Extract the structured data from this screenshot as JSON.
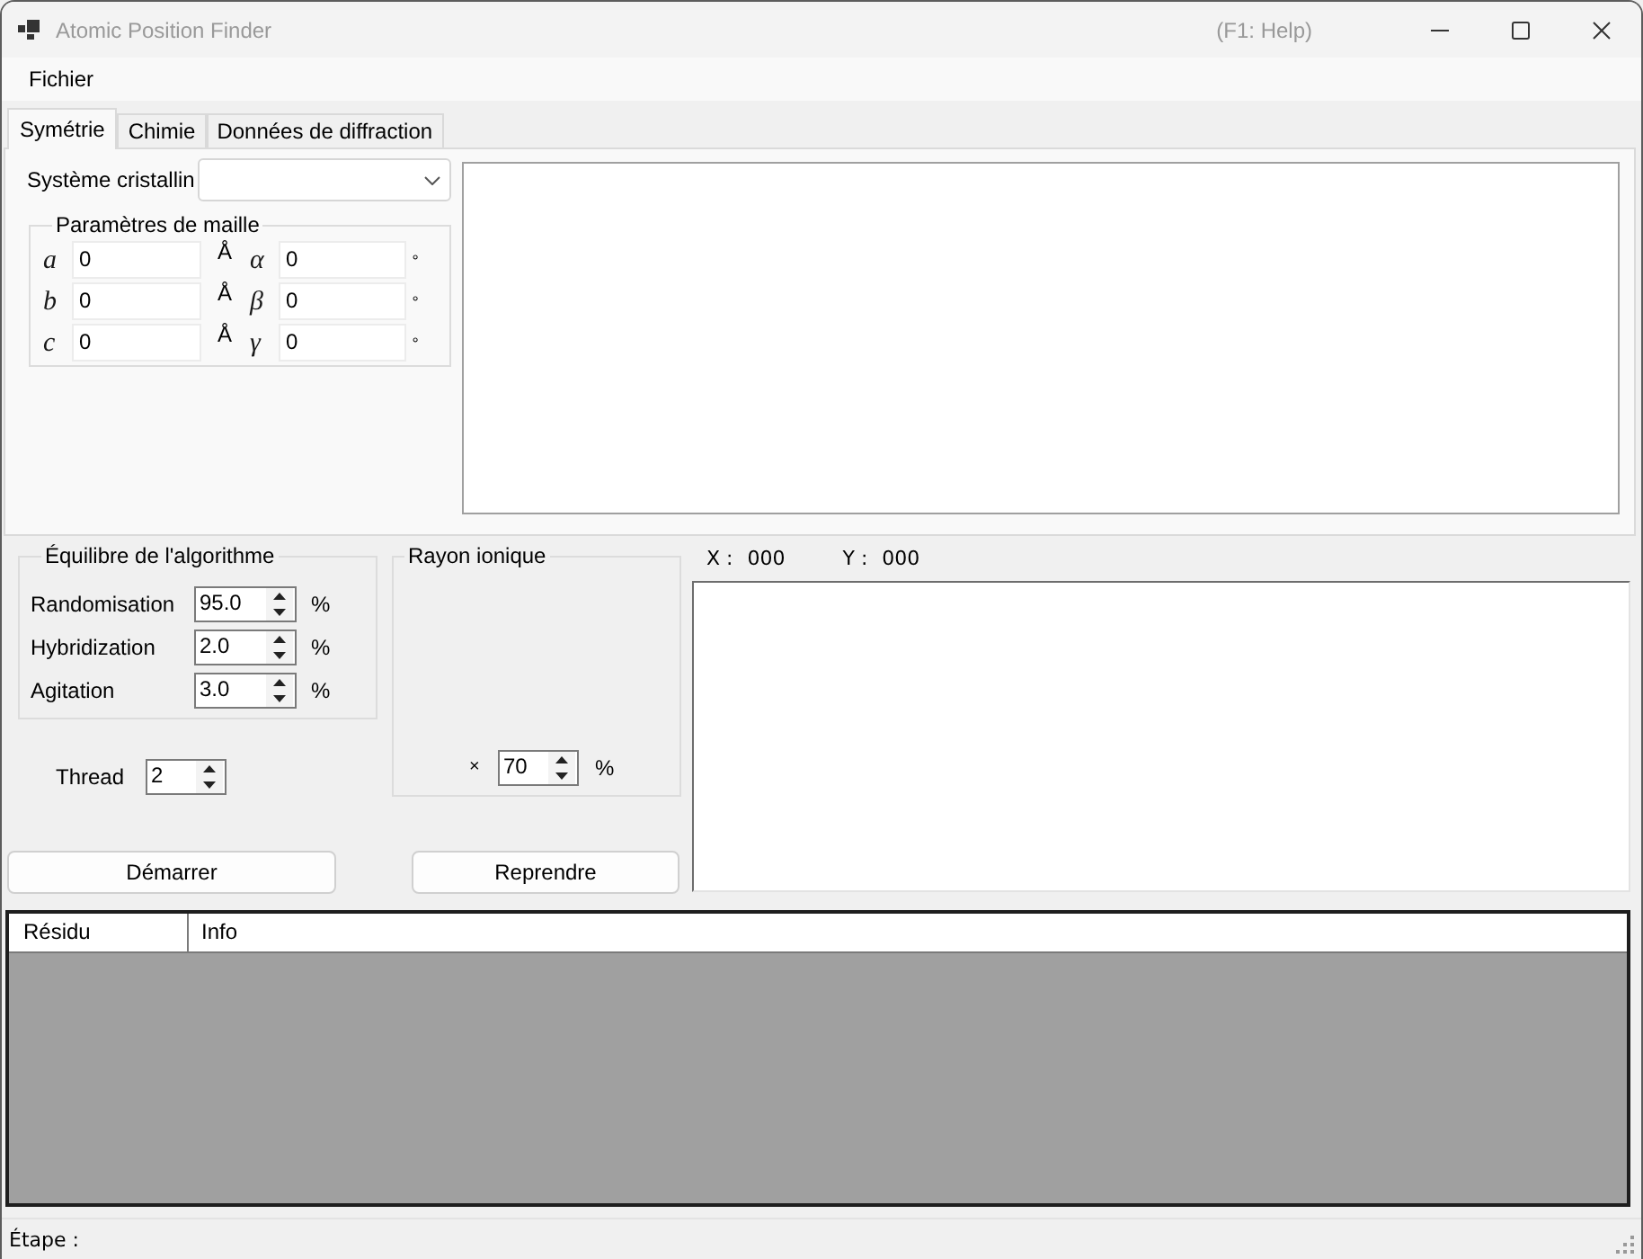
{
  "window": {
    "title": "Atomic Position Finder",
    "help_hint": "(F1: Help)"
  },
  "menu": [
    {
      "label": "Fichier"
    }
  ],
  "tabs": [
    {
      "label": "Symétrie",
      "selected": true
    },
    {
      "label": "Chimie",
      "selected": false
    },
    {
      "label": "Données de diffraction",
      "selected": false
    }
  ],
  "symmetry": {
    "crystal_system": {
      "label": "Système cristallin"
    },
    "lattice": {
      "title": "Paramètres de maille",
      "rows": [
        {
          "length": {
            "symbol": "a",
            "value": "0",
            "unit": "Å"
          },
          "angle": {
            "symbol": "α",
            "value": "0",
            "unit": "°"
          }
        },
        {
          "length": {
            "symbol": "b",
            "value": "0",
            "unit": "Å"
          },
          "angle": {
            "symbol": "β",
            "value": "0",
            "unit": "°"
          }
        },
        {
          "length": {
            "symbol": "c",
            "value": "0",
            "unit": "Å"
          },
          "angle": {
            "symbol": "γ",
            "value": "0",
            "unit": "°"
          }
        }
      ]
    }
  },
  "balance": {
    "title": "Équilibre de l'algorithme",
    "rows": [
      {
        "label": "Randomisation",
        "value": "95.0",
        "unit": "%"
      },
      {
        "label": "Hybridization",
        "value": "2.0",
        "unit": "%"
      },
      {
        "label": "Agitation",
        "value": "3.0",
        "unit": "%"
      }
    ]
  },
  "thread": {
    "label": "Thread",
    "value": "2"
  },
  "ionic_radius": {
    "title": "Rayon ionique",
    "prefix": "×",
    "value": "70",
    "unit": "%"
  },
  "coordinates": [
    {
      "label": "X :",
      "value": "000"
    },
    {
      "label": "Y :",
      "value": "000"
    }
  ],
  "buttons": [
    {
      "label": "Démarrer"
    },
    {
      "label": "Reprendre"
    }
  ],
  "table": {
    "columns": [
      "Résidu",
      "Info"
    ]
  },
  "status_bar": {
    "label": "Étape :"
  }
}
